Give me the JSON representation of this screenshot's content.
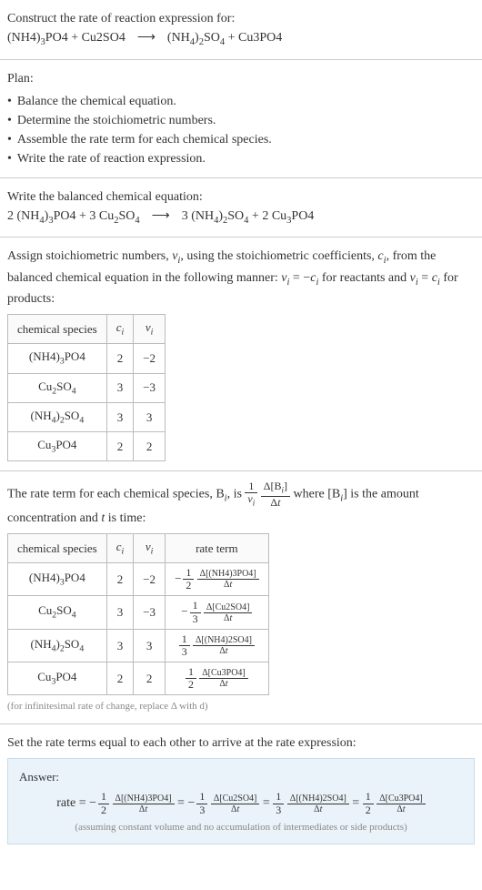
{
  "intro": {
    "title": "Construct the rate of reaction expression for:",
    "eq_lhs1": "(NH4)",
    "eq_lhs1_sub": "3",
    "eq_lhs1b": "PO4",
    "plus": " + ",
    "eq_lhs2": "Cu2SO4",
    "arrow": "⟶",
    "eq_rhs1": "(NH",
    "eq_rhs1_sub4": "4",
    "eq_rhs1_close": ")",
    "eq_rhs1_sub2": "2",
    "eq_rhs1b": "SO",
    "eq_rhs1b_sub": "4",
    "eq_rhs2": "Cu3PO4"
  },
  "plan": {
    "heading": "Plan:",
    "items": [
      "Balance the chemical equation.",
      "Determine the stoichiometric numbers.",
      "Assemble the rate term for each chemical species.",
      "Write the rate of reaction expression."
    ]
  },
  "balanced": {
    "heading": "Write the balanced chemical equation:",
    "c1": "2",
    "c2": "3",
    "c3": "3",
    "c4": "2"
  },
  "assign": {
    "text1": "Assign stoichiometric numbers, ",
    "nu": "ν",
    "sub_i": "i",
    "text2": ", using the stoichiometric coefficients, ",
    "c": "c",
    "text3": ", from the balanced chemical equation in the following manner: ",
    "eq1": " = −",
    "text4": " for reactants and ",
    "eq2": " = ",
    "text5": " for products:",
    "headers": [
      "chemical species",
      "cᵢ",
      "νᵢ"
    ],
    "rows": [
      {
        "species": "(NH4)3PO4",
        "c": "2",
        "nu": "−2"
      },
      {
        "species": "Cu2SO4",
        "c": "3",
        "nu": "−3"
      },
      {
        "species": "(NH4)2SO4",
        "c": "3",
        "nu": "3"
      },
      {
        "species": "Cu3PO4",
        "c": "2",
        "nu": "2"
      }
    ]
  },
  "rateterm": {
    "text1": "The rate term for each chemical species, B",
    "text2": ", is ",
    "text3": " where [B",
    "text4": "] is the amount concentration and ",
    "t": "t",
    "text5": " is time:",
    "delta": "Δ[B",
    "delta2": "]",
    "deltat": "Δt",
    "one": "1",
    "headers": [
      "chemical species",
      "cᵢ",
      "νᵢ",
      "rate term"
    ],
    "rows": [
      {
        "species": "(NH4)3PO4",
        "c": "2",
        "nu": "−2",
        "sign": "−",
        "fnum": "1",
        "fden": "2",
        "dnum": "Δ[(NH4)3PO4]"
      },
      {
        "species": "Cu2SO4",
        "c": "3",
        "nu": "−3",
        "sign": "−",
        "fnum": "1",
        "fden": "3",
        "dnum": "Δ[Cu2SO4]"
      },
      {
        "species": "(NH4)2SO4",
        "c": "3",
        "nu": "3",
        "sign": "",
        "fnum": "1",
        "fden": "3",
        "dnum": "Δ[(NH4)2SO4]"
      },
      {
        "species": "Cu3PO4",
        "c": "2",
        "nu": "2",
        "sign": "",
        "fnum": "1",
        "fden": "2",
        "dnum": "Δ[Cu3PO4]"
      }
    ],
    "note": "(for infinitesimal rate of change, replace Δ with d)",
    "dt": "Δt"
  },
  "final": {
    "heading": "Set the rate terms equal to each other to arrive at the rate expression:",
    "answer_label": "Answer:",
    "rate": "rate",
    "eq": " = ",
    "terms": [
      {
        "sign": "−",
        "fnum": "1",
        "fden": "2",
        "dnum": "Δ[(NH4)3PO4]"
      },
      {
        "sign": "−",
        "fnum": "1",
        "fden": "3",
        "dnum": "Δ[Cu2SO4]"
      },
      {
        "sign": "",
        "fnum": "1",
        "fden": "3",
        "dnum": "Δ[(NH4)2SO4]"
      },
      {
        "sign": "",
        "fnum": "1",
        "fden": "2",
        "dnum": "Δ[Cu3PO4]"
      }
    ],
    "dt": "Δt",
    "note": "(assuming constant volume and no accumulation of intermediates or side products)"
  }
}
